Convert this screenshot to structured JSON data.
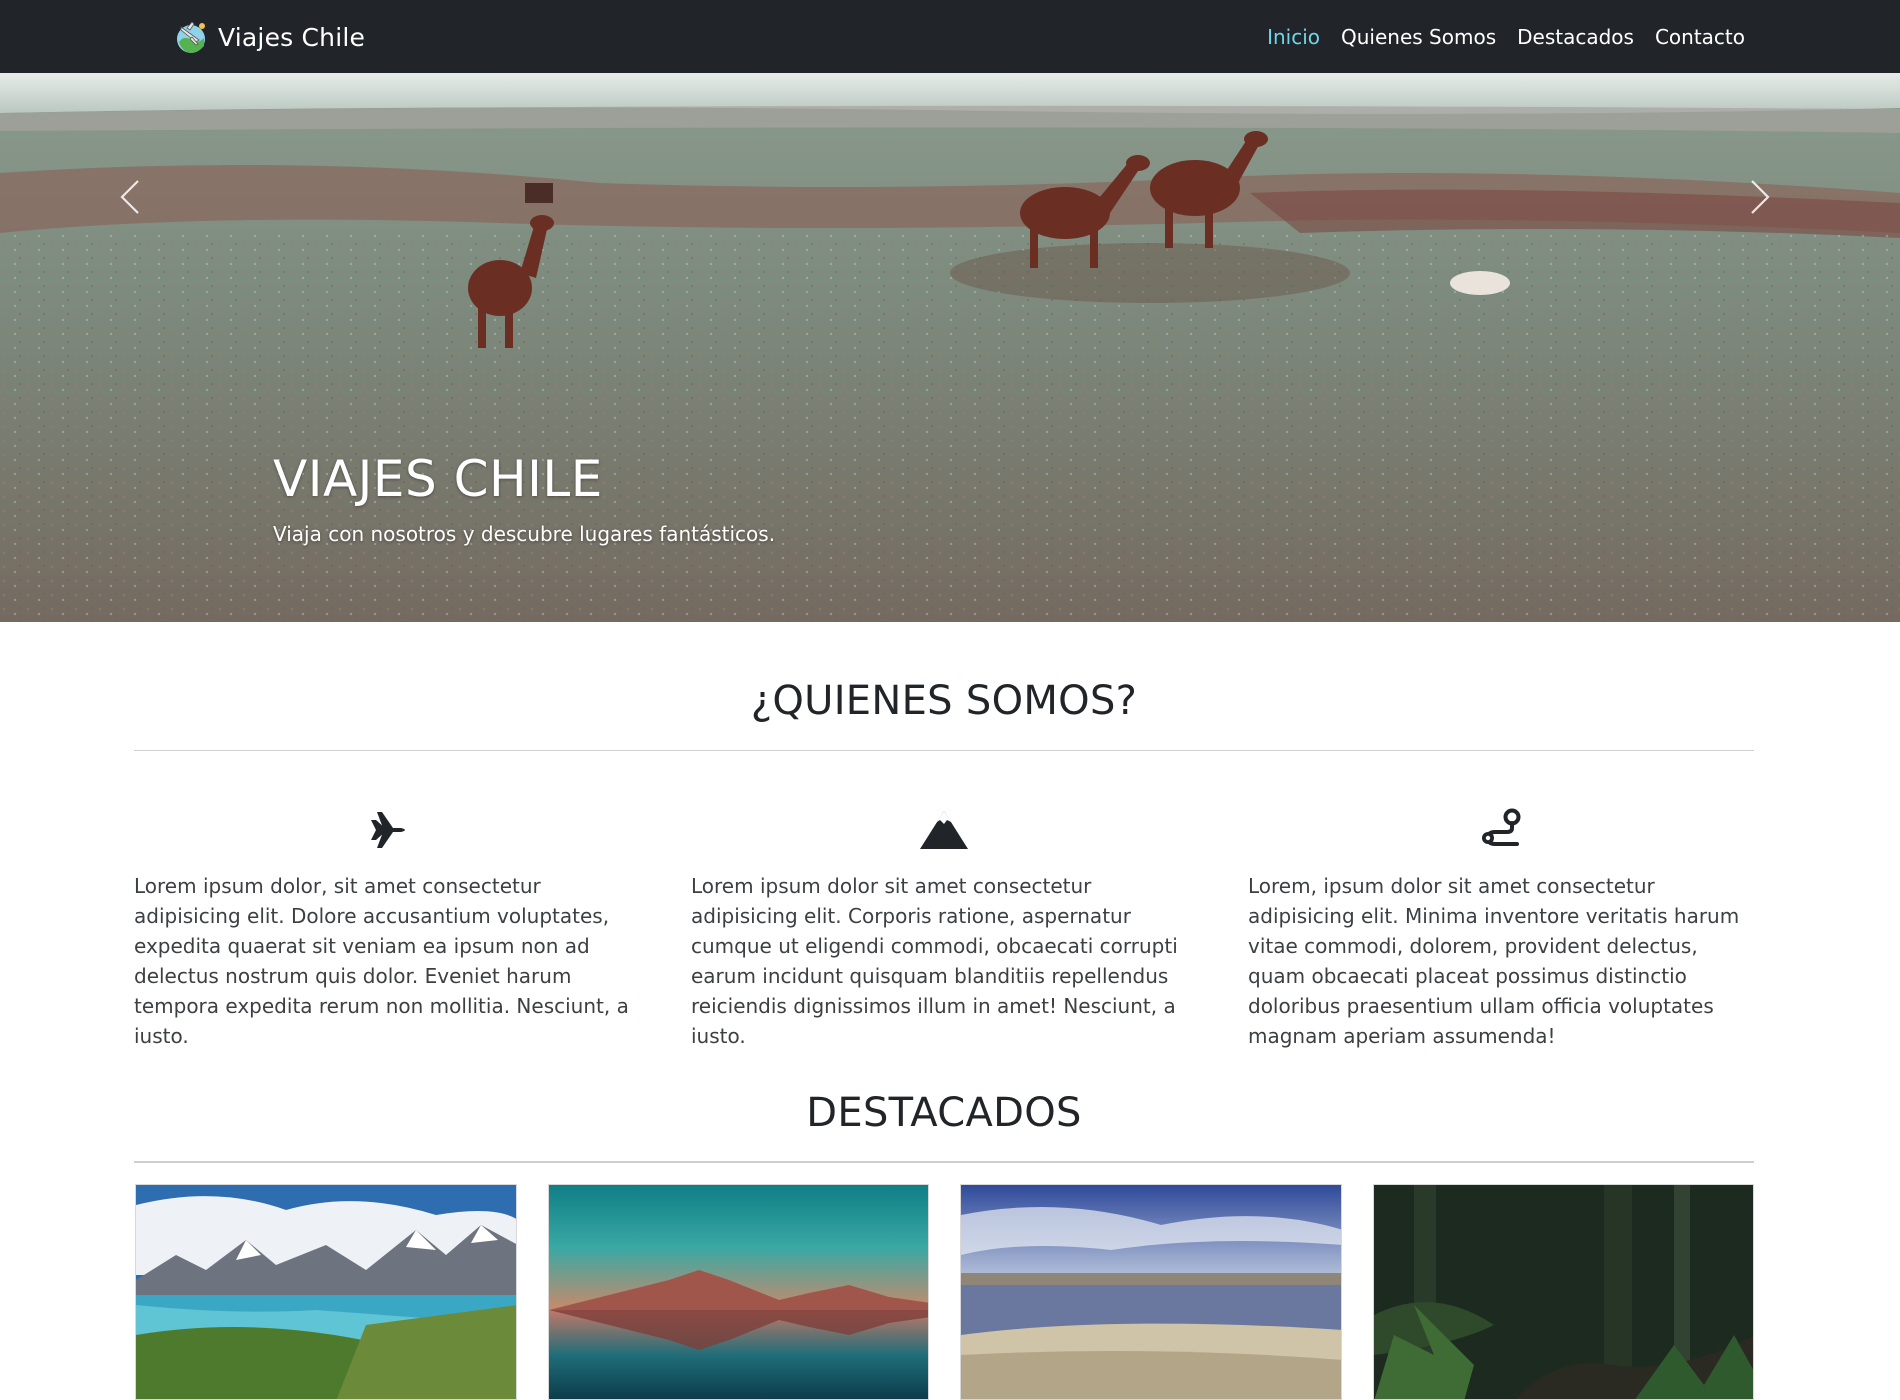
{
  "navbar": {
    "brand": "Viajes Chile",
    "brand_icon": "world-travel-logo-icon",
    "links": [
      {
        "label": "Inicio",
        "active": true
      },
      {
        "label": "Quienes Somos",
        "active": false
      },
      {
        "label": "Destacados",
        "active": false
      },
      {
        "label": "Contacto",
        "active": false
      }
    ],
    "active_color": "#6fd6e9",
    "background": "#21252a"
  },
  "hero": {
    "title": "VIAJES CHILE",
    "subtitle": "Viaja con nosotros y descubre lugares fantásticos.",
    "prev_icon": "chevron-left-icon",
    "next_icon": "chevron-right-icon"
  },
  "about": {
    "title": "¿QUIENES SOMOS?",
    "features": [
      {
        "icon": "airplane-icon",
        "text": "Lorem ipsum dolor, sit amet consectetur adipisicing elit. Dolore accusantium voluptates, expedita quaerat sit veniam ea ipsum non ad delectus nostrum quis dolor. Eveniet harum tempora expedita rerum non mollitia. Nesciunt, a iusto."
      },
      {
        "icon": "mountain-icon",
        "text": "Lorem ipsum dolor sit amet consectetur adipisicing elit. Corporis ratione, aspernatur cumque ut eligendi commodi, obcaecati corrupti earum incidunt quisquam blanditiis repellendus reiciendis dignissimos illum in amet! Nesciunt, a iusto."
      },
      {
        "icon": "route-icon",
        "text": "Lorem, ipsum dolor sit amet consectetur adipisicing elit. Minima inventore veritatis harum vitae commodi, dolorem, provident delectus, quam obcaecati placeat possimus distinctio doloribus praesentium ullam officia voluptates magnam aperiam assumenda!"
      }
    ]
  },
  "featured": {
    "title": "DESTACADOS",
    "cards": [
      {
        "image": "torres-del-paine-photo"
      },
      {
        "image": "volcano-lake-reflection-photo"
      },
      {
        "image": "salt-flat-lagoon-photo"
      },
      {
        "image": "forest-path-photo"
      }
    ]
  }
}
